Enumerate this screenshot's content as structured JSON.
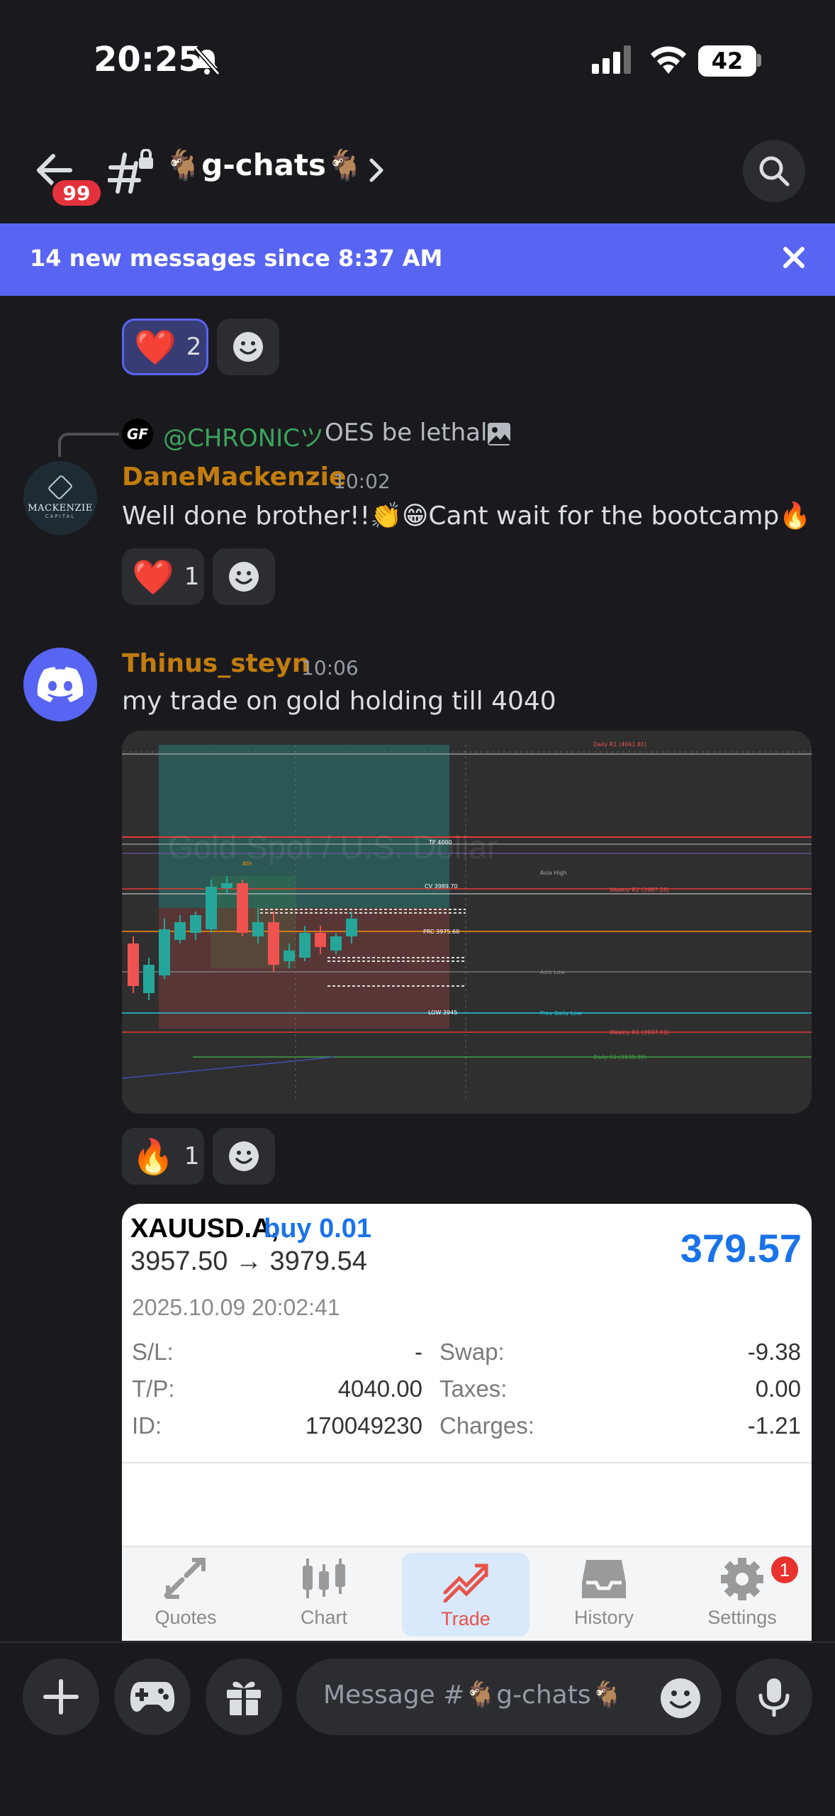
{
  "status_bar": {
    "time": "20:25",
    "battery": "42"
  },
  "header": {
    "unread_count": "99",
    "channel_name": "🐐g-chats🐐"
  },
  "banner": {
    "text": "14 new messages since 8:37 AM"
  },
  "reactions_top": [
    {
      "emoji": "❤️",
      "count": "2"
    }
  ],
  "messages": [
    {
      "reply": {
        "mention": "@CHRONICツ",
        "text": "OES be lethal",
        "avatar_text": "GF"
      },
      "avatar": {
        "name": "MACKENZIE",
        "sub": "CAPITAL"
      },
      "username": "DaneMackenzie",
      "time": "10:02",
      "text": "Well done brother!!👏😁Cant wait for the bootcamp🔥",
      "reactions": [
        {
          "emoji": "❤️",
          "count": "1"
        }
      ]
    },
    {
      "username": "Thinus_steyn",
      "time": "10:06",
      "text": "my trade on gold holding till 4040",
      "reactions": [
        {
          "emoji": "🔥",
          "count": "1"
        }
      ]
    }
  ],
  "chart_attachment": {
    "watermark": "Gold Spot / U.S. Dollar",
    "labels": {
      "daily_r1": "Daily R1 (4041.81)",
      "tp": "TP 4000",
      "weekly_r2": "Weekly R2 (3987.28)",
      "cv": "CV 3989.70",
      "asia_high": "Asia High",
      "prc": "PRC 3975.60",
      "asia_low": "Asia Low",
      "low": "LOW 3945",
      "prev_daily_low": "Prev Daily Low",
      "weekly_r1": "Weekly R1 (3937.11)",
      "daily_s1": "Daily S1 (3938.39)",
      "ath": "Ath"
    },
    "colors": {
      "bull": "#26a69a",
      "bear": "#ef5350"
    }
  },
  "trade_card": {
    "symbol": "XAUUSD.A,",
    "side": "buy 0.01",
    "prices": "3957.50 → 3979.54",
    "profit": "379.57",
    "date": "2025.10.09 20:02:41",
    "rows_left": [
      {
        "label": "S/L:",
        "value": "-"
      },
      {
        "label": "T/P:",
        "value": "4040.00"
      },
      {
        "label": "ID:",
        "value": "170049230"
      }
    ],
    "rows_right": [
      {
        "label": "Swap:",
        "value": "-9.38"
      },
      {
        "label": "Taxes:",
        "value": "0.00"
      },
      {
        "label": "Charges:",
        "value": "-1.21"
      }
    ],
    "nav": [
      {
        "label": "Quotes",
        "icon": "quotes-icon"
      },
      {
        "label": "Chart",
        "icon": "chart-icon"
      },
      {
        "label": "Trade",
        "icon": "trade-icon",
        "active": true
      },
      {
        "label": "History",
        "icon": "history-icon"
      },
      {
        "label": "Settings",
        "icon": "settings-icon",
        "badge": "1"
      }
    ],
    "accent": "#1a73e8"
  },
  "composer": {
    "placeholder": "Message #🐐g-chats🐐"
  },
  "colors": {
    "banner": "#5865f2",
    "username": "#c27c0e",
    "mention": "#3ba55d",
    "badge": "#e3323b"
  }
}
